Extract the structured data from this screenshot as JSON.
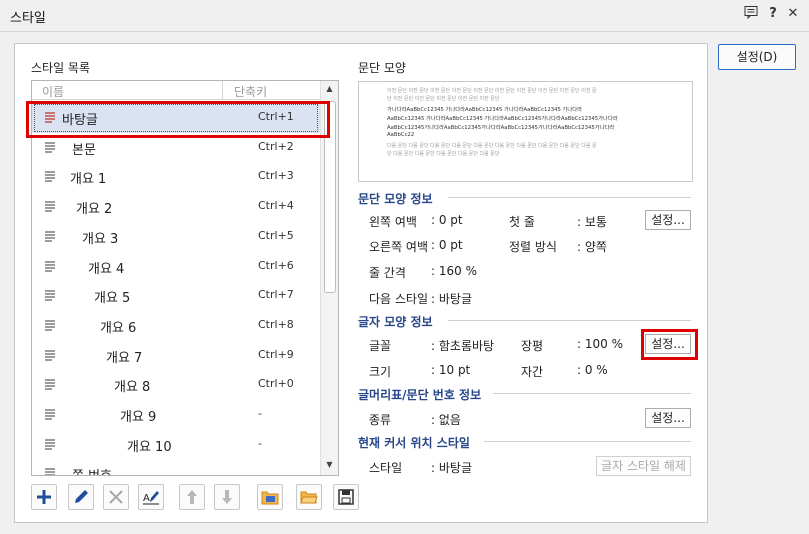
{
  "window": {
    "title": "스타일",
    "help_glyph": "?",
    "close_glyph": "✕"
  },
  "list": {
    "section_label": "스타일 목록",
    "col_name": "이름",
    "col_key": "단축키",
    "items": [
      {
        "name": "바탕글",
        "key": "Ctrl+1"
      },
      {
        "name": "본문",
        "key": "Ctrl+2"
      },
      {
        "name": "개요 1",
        "key": "Ctrl+3"
      },
      {
        "name": "개요 2",
        "key": "Ctrl+4"
      },
      {
        "name": "개요 3",
        "key": "Ctrl+5"
      },
      {
        "name": "개요 4",
        "key": "Ctrl+6"
      },
      {
        "name": "개요 5",
        "key": "Ctrl+7"
      },
      {
        "name": "개요 6",
        "key": "Ctrl+8"
      },
      {
        "name": "개요 7",
        "key": "Ctrl+9"
      },
      {
        "name": "개요 8",
        "key": "Ctrl+0"
      },
      {
        "name": "개요 9",
        "key": "-"
      },
      {
        "name": "개요 10",
        "key": "-"
      },
      {
        "name": "쪽 번호",
        "key": ""
      }
    ]
  },
  "toolbar_icons": [
    "add-style-icon",
    "edit-style-icon",
    "delete-style-icon",
    "replace-style-icon",
    "move-up-icon",
    "move-down-icon",
    "import-style-icon",
    "open-folder-icon",
    "save-style-icon"
  ],
  "preview": {
    "label": "문단 모양",
    "prev_lines": [
      "이전 문단 이전 문단 이전 문단 이전 문단 이전 문단 이전 문단 이전 문단 이전 문단 이전 문단 이전 문",
      "단 이전 문단 이전 문단 이전 문단 이전 문단 이전 문단"
    ],
    "cur_lines": [
      "가나다라AaBbCc12345   가나다라AaBbCc12345   가나다라AaBbCc12345   가나다라",
      "AaBbCc12345 가나다라AaBbCc12345 가나다라AaBbCc12345가나다라AaBbCc12345가나다라",
      "AaBbCc12345가나다라AaBbCc12345가나다라AaBbCc12345가나다라AaBbCc12345가나다라",
      "AaBbCc22"
    ],
    "next_lines": [
      "다음 문단 다음 문단 다음 문단 다음 문단 다음 문단 다음 문단 다음 문단 다음 문단 다음 문단 다음 문",
      "단 다음 문단 다음 문단 다음 문단 다음 문단 다음 문단"
    ]
  },
  "para_info": {
    "header": "문단 모양 정보",
    "left_margin_label": "왼쪽 여백",
    "left_margin_value": ": 0 pt",
    "right_margin_label": "오른쪽 여백",
    "right_margin_value": ": 0 pt",
    "line_spacing_label": "줄 간격",
    "line_spacing_value": ": 160 %",
    "next_style_label": "다음 스타일",
    "next_style_value": ": 바탕글",
    "first_line_label": "첫 줄",
    "first_line_value": ": 보통",
    "align_label": "정렬 방식",
    "align_value": ": 양쪽",
    "settings_button": "설정..."
  },
  "char_info": {
    "header": "글자 모양 정보",
    "font_label": "글꼴",
    "font_value": ": 함초롬바탕",
    "size_label": "크기",
    "size_value": ": 10 pt",
    "width_label": "장평",
    "width_value": ": 100 %",
    "spacing_label": "자간",
    "spacing_value": ": 0 %",
    "settings_button": "설정..."
  },
  "bullet_info": {
    "header": "글머리표/문단 번호 정보",
    "type_label": "종류",
    "type_value": ": 없음",
    "settings_button": "설정..."
  },
  "cursor_info": {
    "header": "현재 커서 위치 스타일",
    "style_label": "스타일",
    "style_value": ": 바탕글",
    "clear_button": "글자 스타일 해제"
  },
  "actions": {
    "set_button": "설정(D)"
  },
  "colors": {
    "accent": "#2e6bc9",
    "highlight": "#e00000",
    "section_header": "#27478a",
    "selection": "#dbe3f2"
  }
}
